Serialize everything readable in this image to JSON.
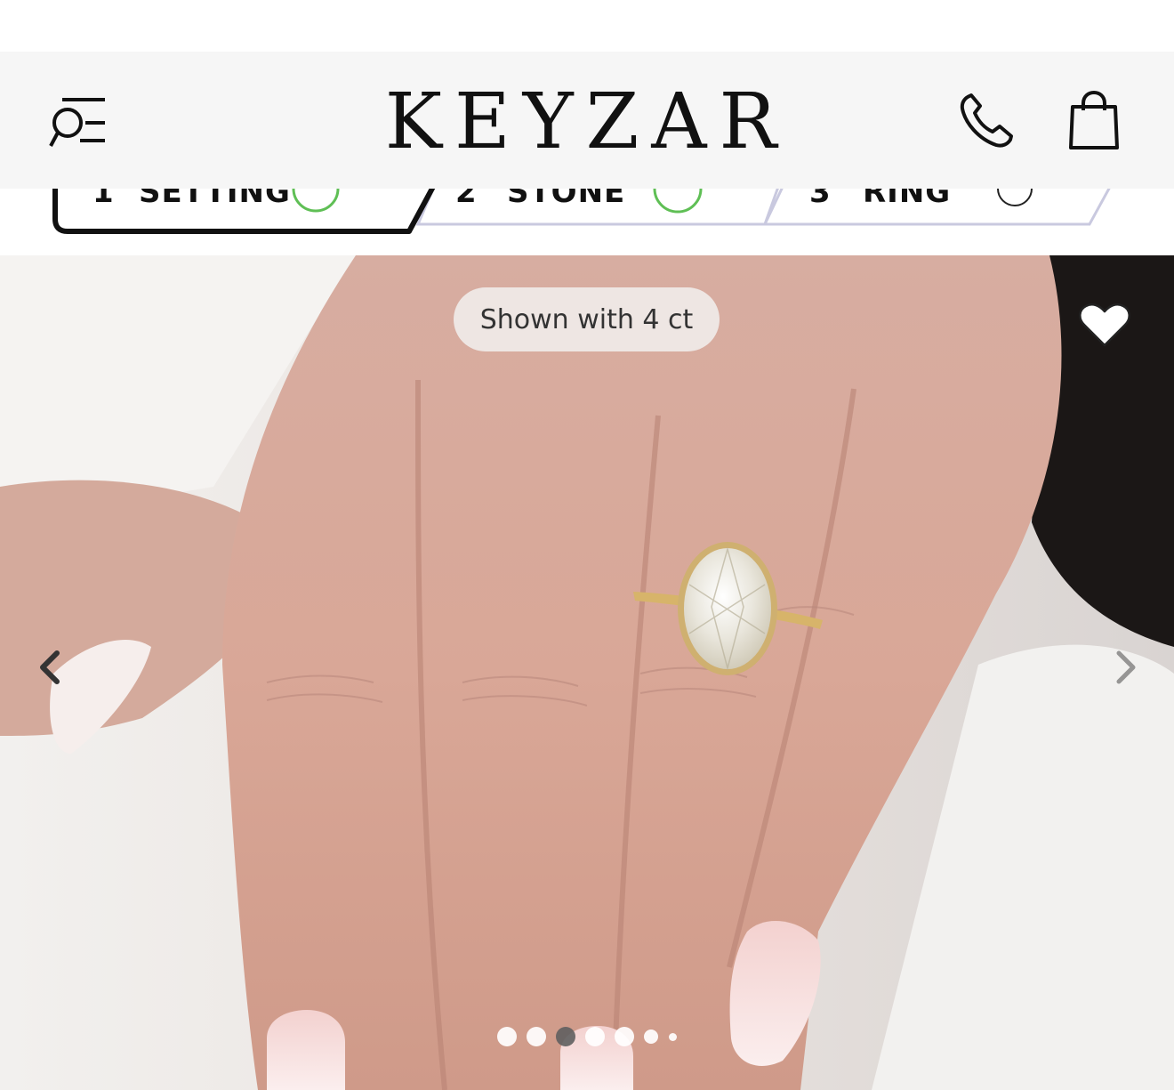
{
  "header": {
    "logo_text": "KEYZAR",
    "menu_icon": "menu-search-icon",
    "phone_icon": "phone-icon",
    "bag_icon": "shopping-bag-icon"
  },
  "steps": [
    {
      "number": "1",
      "label": "SETTING",
      "status": "completed",
      "status_color": "#5fbf55"
    },
    {
      "number": "2",
      "label": "STONE",
      "status": "completed",
      "status_color": "#5fbf55"
    },
    {
      "number": "3",
      "label": "RING",
      "status": "pending",
      "status_color": "#222222"
    }
  ],
  "hero": {
    "badge_text": "Shown with 4 ct",
    "favorite_icon": "heart-icon",
    "prev_icon": "chevron-left-icon",
    "next_icon": "chevron-right-icon"
  },
  "carousel": {
    "total_dots": 7,
    "active_index": 2
  },
  "colors": {
    "header_bg": "#f6f6f6",
    "active_step_border": "#111111",
    "inactive_step_border": "#c9c9df",
    "check_green": "#5fbf55"
  }
}
